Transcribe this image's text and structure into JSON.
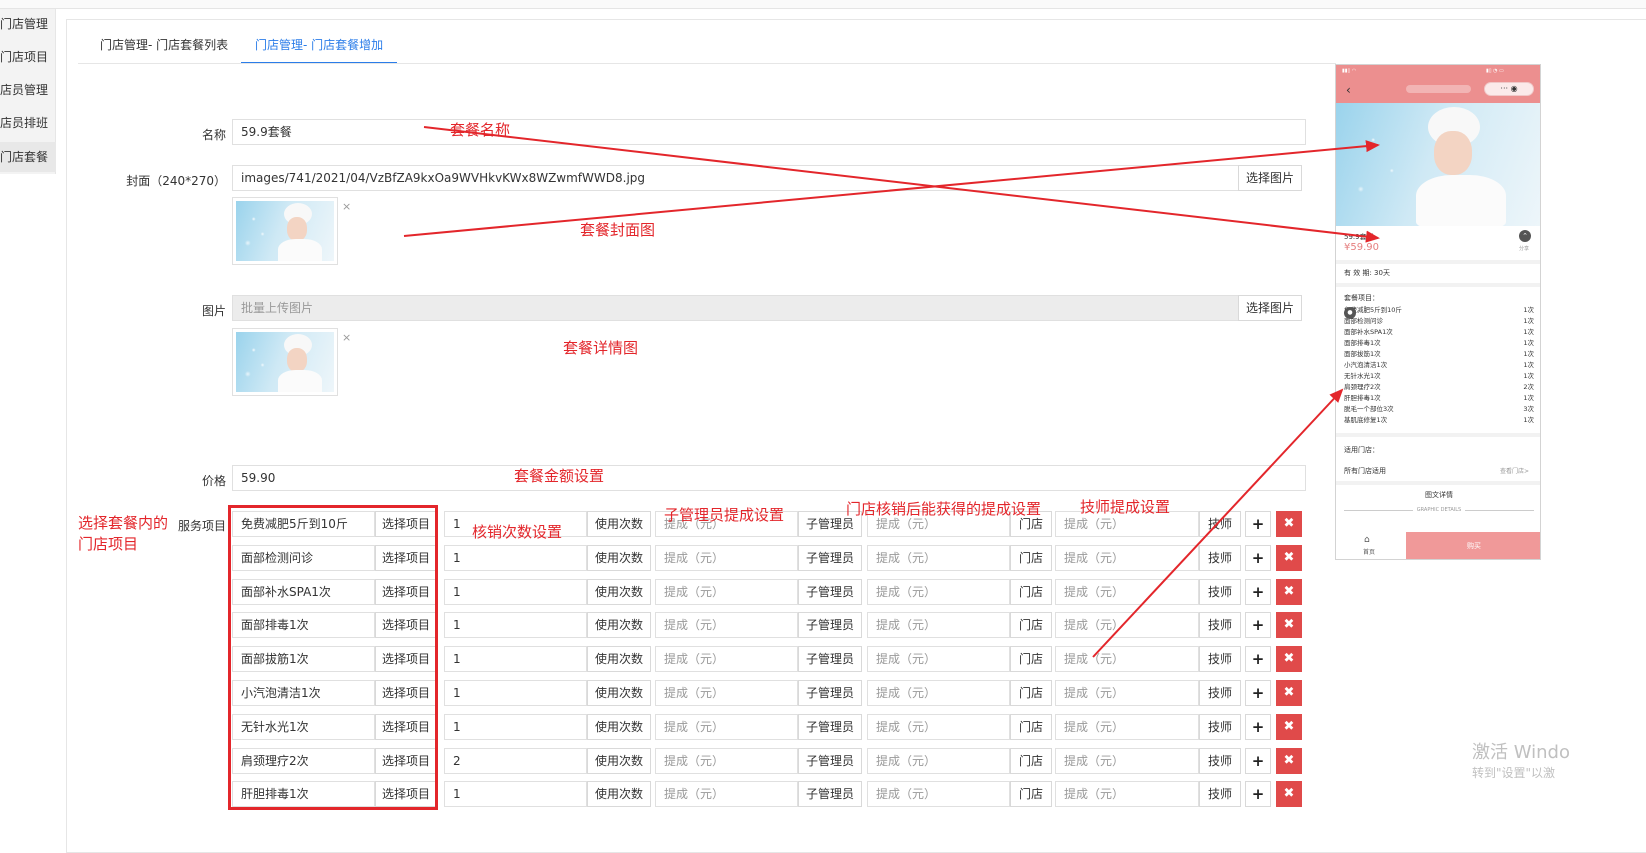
{
  "sidebar": {
    "items": [
      {
        "label": "门店管理"
      },
      {
        "label": "门店项目"
      },
      {
        "label": "店员管理"
      },
      {
        "label": "店员排班"
      },
      {
        "label": "门店套餐",
        "active": true
      }
    ]
  },
  "tabs": [
    {
      "label": "门店管理- 门店套餐列表"
    },
    {
      "label": "门店管理- 门店套餐增加",
      "active": true
    }
  ],
  "form": {
    "name_label": "名称",
    "name_value": "59.9套餐",
    "cover_label": "封面（240*270）",
    "cover_value": "images/741/2021/04/VzBfZA9kxOa9WVHkvKWx8WZwmfWWD8.jpg",
    "select_image_btn": "选择图片",
    "images_label": "图片",
    "images_placeholder": "批量上传图片",
    "remove_mark": "×",
    "price_label": "价格",
    "price_value": "59.90",
    "services_label": "服务项目"
  },
  "services": {
    "select_item_btn": "选择项目",
    "count_addon": "使用次数",
    "commission_placeholder": "提成（元）",
    "sub_manager_addon": "子管理员",
    "store_addon": "门店",
    "technician_addon": "技师",
    "add_icon": "+",
    "delete_icon": "✖",
    "rows": [
      {
        "item": "免费减肥5斤到10斤",
        "count": "1"
      },
      {
        "item": "面部检测问诊",
        "count": "1"
      },
      {
        "item": "面部补水SPA1次",
        "count": "1"
      },
      {
        "item": "面部排毒1次",
        "count": "1"
      },
      {
        "item": "面部拔筋1次",
        "count": "1"
      },
      {
        "item": "小汽泡清洁1次",
        "count": "1"
      },
      {
        "item": "无针水光1次",
        "count": "1"
      },
      {
        "item": "肩颈理疗2次",
        "count": "2"
      },
      {
        "item": "肝胆排毒1次",
        "count": "1"
      }
    ]
  },
  "annotations": {
    "name": "套餐名称",
    "cover": "套餐封面图",
    "detail": "套餐详情图",
    "price": "套餐金额设置",
    "select_items_line1": "选择套餐内的",
    "select_items_line2": "门店项目",
    "count": "核销次数设置",
    "sub_manager": "子管理员提成设置",
    "store": "门店核销后能获得的提成设置",
    "technician": "技师提成设置",
    "color": "#e3262b"
  },
  "phone_preview": {
    "caps": "··· ◉",
    "name": "59.9套餐",
    "price": "¥59.90",
    "share_label": "分享",
    "validity": "有 效 期:  30天",
    "items_header": "套餐项目：",
    "items": [
      {
        "name": "免费减肥5斤到10斤",
        "count": "1次"
      },
      {
        "name": "面部检测问诊",
        "count": "1次"
      },
      {
        "name": "面部补水SPA1次",
        "count": "1次"
      },
      {
        "name": "面部排毒1次",
        "count": "1次"
      },
      {
        "name": "面部拔筋1次",
        "count": "1次"
      },
      {
        "name": "小汽泡清洁1次",
        "count": "1次"
      },
      {
        "name": "无针水光1次",
        "count": "1次"
      },
      {
        "name": "肩颈理疗2次",
        "count": "2次"
      },
      {
        "name": "肝胆排毒1次",
        "count": "1次"
      },
      {
        "name": "脱毛一个部位3次",
        "count": "3次"
      },
      {
        "name": "基肌底修复1次",
        "count": "1次"
      }
    ],
    "store_header": "适用门店：",
    "store_value": "所有门店适用",
    "view_store": "查看门店>",
    "detail_title": "图文详情",
    "detail_subtitle": "GRAPHIC DETAILS",
    "home_label": "首页",
    "buy_label": "购买",
    "accent_color": "#ec8f8f"
  },
  "watermark": {
    "line1": "激活 Windo",
    "line2": "转到\"设置\"以激"
  }
}
